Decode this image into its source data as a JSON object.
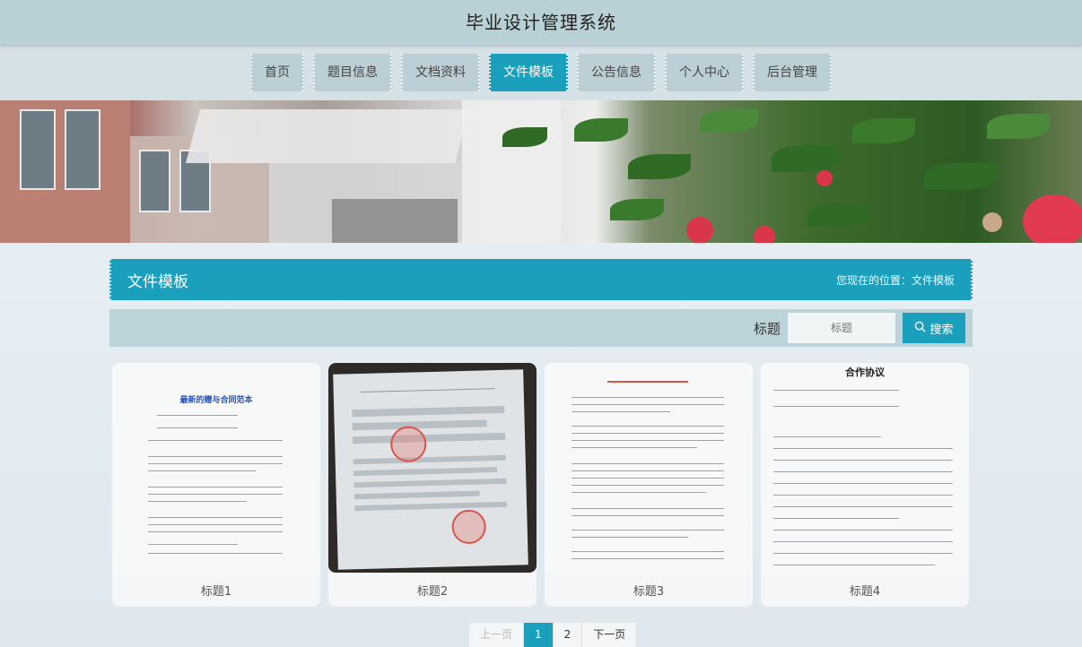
{
  "header": {
    "title": "毕业设计管理系统"
  },
  "nav": [
    {
      "label": "首页",
      "active": false
    },
    {
      "label": "题目信息",
      "active": false
    },
    {
      "label": "文档资料",
      "active": false
    },
    {
      "label": "文件模板",
      "active": true
    },
    {
      "label": "公告信息",
      "active": false
    },
    {
      "label": "个人中心",
      "active": false
    },
    {
      "label": "后台管理",
      "active": false
    }
  ],
  "section": {
    "title": "文件模板",
    "location": "您现在的位置：文件模板"
  },
  "search": {
    "label": "标题",
    "placeholder": "标题",
    "button": "搜索"
  },
  "cards": [
    {
      "caption": "标题1",
      "doc_heading": "最新的赠与合同范本"
    },
    {
      "caption": "标题2"
    },
    {
      "caption": "标题3"
    },
    {
      "caption": "标题4",
      "doc_heading": "合作协议"
    }
  ],
  "pagination": {
    "prev": "上一页",
    "pages": [
      "1",
      "2"
    ],
    "current": "1",
    "next": "下一页"
  },
  "colors": {
    "accent": "#1aa0bd",
    "header_bg": "#b9d0d6",
    "nav_bg": "#d4e1e7"
  }
}
